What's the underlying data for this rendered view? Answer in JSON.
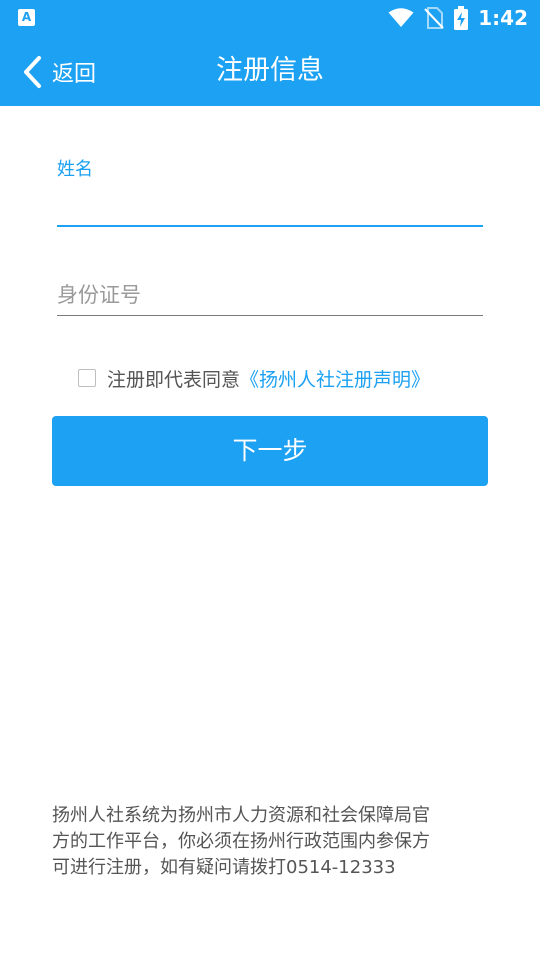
{
  "status_bar": {
    "time": "1:42",
    "app_badge": "A",
    "icons": [
      "wifi-icon",
      "no-sim-icon",
      "battery-charging-icon"
    ]
  },
  "app_bar": {
    "back_label": "返回",
    "title": "注册信息"
  },
  "form": {
    "name_label": "姓名",
    "name_value": "",
    "id_placeholder": "身份证号",
    "agree_prefix": "注册即代表同意",
    "agree_link": "《扬州人社注册声明》",
    "agree_checked": false,
    "next_label": "下一步"
  },
  "footer": {
    "line1": "扬州人社系统为扬州市人力资源和社会保障局官",
    "line2": "方的工作平台，你必须在扬州行政范围内参保方",
    "line3": "可进行注册，如有疑问请拨打0514-12333"
  },
  "colors": {
    "primary": "#1da1f2",
    "text_gray": "#555555",
    "placeholder_gray": "#9a9a9a"
  }
}
